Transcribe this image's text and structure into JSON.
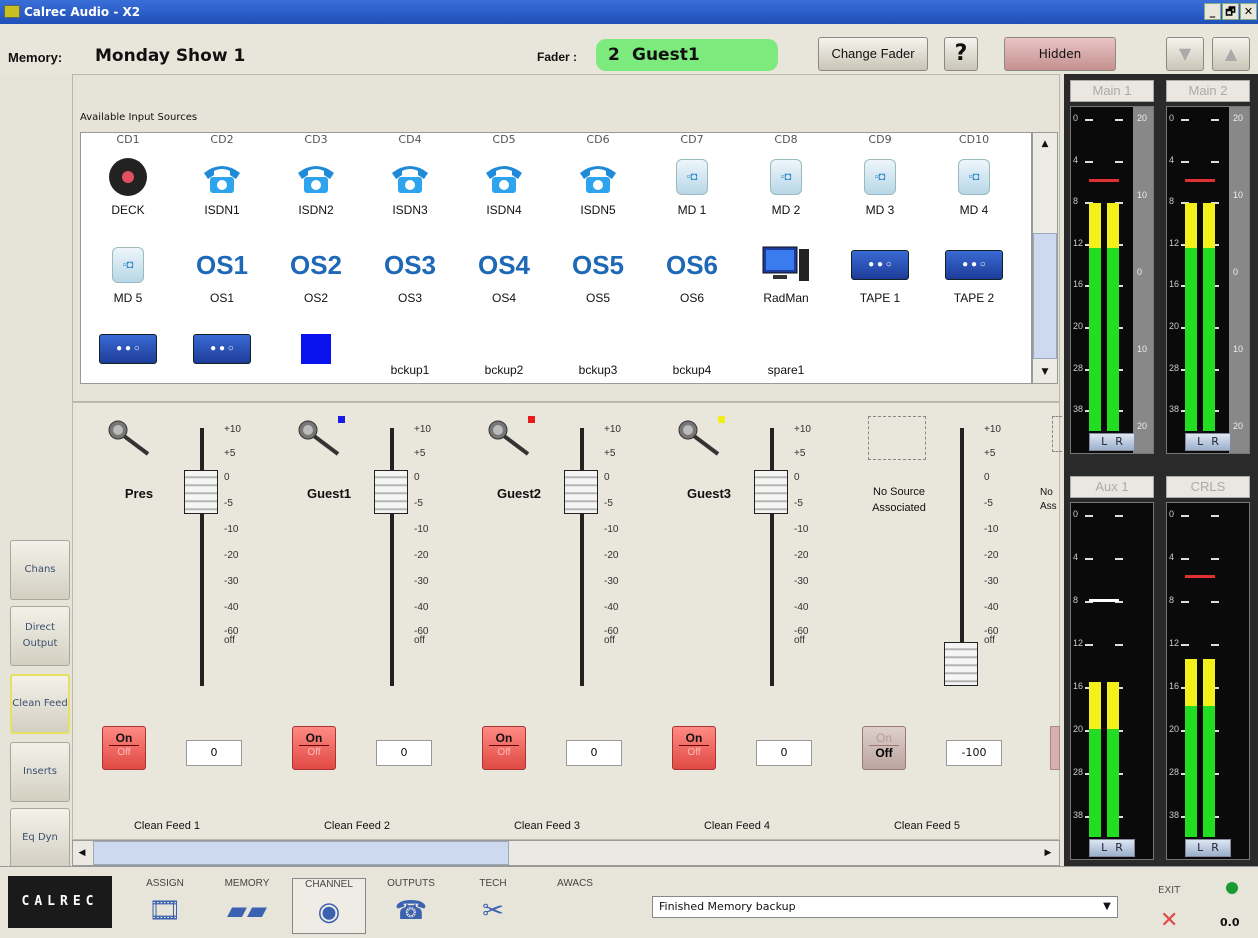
{
  "window": {
    "title": "Calrec Audio - X2",
    "controls": [
      "_",
      "🗗",
      "✕"
    ]
  },
  "header": {
    "memory_label": "Memory:",
    "memory_name": "Monday Show 1",
    "fader_label": "Fader :",
    "fader_number": "2",
    "fader_name": "Guest1",
    "change_fader": "Change Fader",
    "help": "?",
    "hidden": "Hidden"
  },
  "sources": {
    "title": "Available Input Sources",
    "headers": [
      "CD1",
      "CD2",
      "CD3",
      "CD4",
      "CD5",
      "CD6",
      "CD7",
      "CD8",
      "CD9",
      "CD10"
    ],
    "rows": [
      [
        {
          "name": "DECK",
          "icon": "deck-icon"
        },
        {
          "name": "ISDN1",
          "icon": "phone-icon"
        },
        {
          "name": "ISDN2",
          "icon": "phone-icon"
        },
        {
          "name": "ISDN3",
          "icon": "phone-icon"
        },
        {
          "name": "ISDN4",
          "icon": "phone-icon"
        },
        {
          "name": "ISDN5",
          "icon": "phone-icon"
        },
        {
          "name": "MD 1",
          "icon": "minidisc-icon"
        },
        {
          "name": "MD 2",
          "icon": "minidisc-icon"
        },
        {
          "name": "MD 3",
          "icon": "minidisc-icon"
        },
        {
          "name": "MD 4",
          "icon": "minidisc-icon"
        }
      ],
      [
        {
          "name": "MD 5",
          "icon": "minidisc-icon"
        },
        {
          "name": "OS1",
          "icon": "OS1"
        },
        {
          "name": "OS2",
          "icon": "OS2"
        },
        {
          "name": "OS3",
          "icon": "OS3"
        },
        {
          "name": "OS4",
          "icon": "OS4"
        },
        {
          "name": "OS5",
          "icon": "OS5"
        },
        {
          "name": "OS6",
          "icon": "OS6"
        },
        {
          "name": "RadMan",
          "icon": "computer-icon"
        },
        {
          "name": "TAPE 1",
          "icon": "tape-icon"
        },
        {
          "name": "TAPE 2",
          "icon": "tape-icon"
        }
      ],
      [
        {
          "name": "",
          "icon": "tape-icon"
        },
        {
          "name": "",
          "icon": "tape-icon"
        },
        {
          "name": "",
          "icon": "blue-square-icon"
        },
        {
          "name": "bckup1",
          "icon": ""
        },
        {
          "name": "bckup2",
          "icon": ""
        },
        {
          "name": "bckup3",
          "icon": ""
        },
        {
          "name": "bckup4",
          "icon": ""
        },
        {
          "name": "spare1",
          "icon": ""
        }
      ]
    ]
  },
  "side_tabs": [
    {
      "label": "Chans"
    },
    {
      "label": "Direct Output"
    },
    {
      "label": "Clean Feed"
    },
    {
      "label": "Inserts"
    },
    {
      "label": "Eq Dyn"
    }
  ],
  "scale": [
    "+10",
    "+5",
    "0",
    "-5",
    "-10",
    "-20",
    "-30",
    "-40",
    "-60",
    "off"
  ],
  "channels": [
    {
      "name": "Pres",
      "badge": "",
      "fader_db": "0",
      "on": "On",
      "off": "Off",
      "value": "0",
      "feed": "Clean Feed 1"
    },
    {
      "name": "Guest1",
      "badge": "#1a1ae8",
      "fader_db": "0",
      "on": "On",
      "off": "Off",
      "value": "0",
      "feed": "Clean Feed 2"
    },
    {
      "name": "Guest2",
      "badge": "#e81a1a",
      "fader_db": "0",
      "on": "On",
      "off": "Off",
      "value": "0",
      "feed": "Clean Feed 3"
    },
    {
      "name": "Guest3",
      "badge": "#f2ee1a",
      "fader_db": "0",
      "on": "On",
      "off": "Off",
      "value": "0",
      "feed": "Clean Feed 4"
    },
    {
      "name": "No Source Associated",
      "badge": "",
      "fader_db": "-60",
      "on": "On",
      "off": "Off",
      "value": "-100",
      "feed": "Clean Feed 5",
      "inactive": true
    }
  ],
  "partial_channel": {
    "name": "No Ass"
  },
  "meters": [
    {
      "title": "Main 1",
      "scale": [
        "0",
        "4",
        "8",
        "12",
        "16",
        "20",
        "28",
        "38"
      ],
      "right_scale": [
        "20",
        "10",
        "0",
        "10",
        "20"
      ],
      "levels": [
        0.7,
        0.7
      ],
      "peak_color": "#e03030"
    },
    {
      "title": "Main 2",
      "scale": [
        "0",
        "4",
        "8",
        "12",
        "16",
        "20",
        "28",
        "38"
      ],
      "right_scale": [
        "20",
        "10",
        "0",
        "10",
        "20"
      ],
      "levels": [
        0.7,
        0.7
      ],
      "peak_color": "#e03030"
    },
    {
      "title": "Aux 1",
      "scale": [
        "0",
        "4",
        "8",
        "12",
        "16",
        "20",
        "28",
        "38"
      ],
      "levels": [
        0.46,
        0.46
      ],
      "peak_color": "#ffffff"
    },
    {
      "title": "CRLS",
      "scale": [
        "0",
        "4",
        "8",
        "12",
        "16",
        "20",
        "28",
        "38"
      ],
      "levels": [
        0.53,
        0.53
      ],
      "peak_color": "#e03030"
    }
  ],
  "meter_lr": [
    "L",
    "R"
  ],
  "nav": [
    {
      "label": "ASSIGN",
      "icon": "assign-icon"
    },
    {
      "label": "MEMORY",
      "icon": "memory-icon"
    },
    {
      "label": "CHANNEL",
      "icon": "channel-icon"
    },
    {
      "label": "OUTPUTS",
      "icon": "outputs-icon"
    },
    {
      "label": "TECH",
      "icon": "tools-icon"
    },
    {
      "label": "AWACS",
      "icon": ""
    }
  ],
  "brand": "CALREC",
  "status": {
    "message": "Finished Memory backup",
    "exit": "EXIT",
    "value": "0.0",
    "led_color": "#1a9a34"
  }
}
